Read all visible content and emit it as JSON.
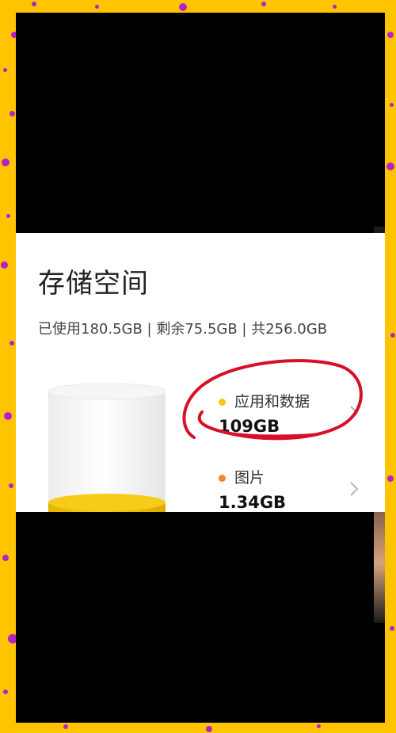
{
  "storage": {
    "title": "存储空间",
    "summary": "已使用180.5GB | 剩余75.5GB | 共256.0GB",
    "categories": [
      {
        "label": "应用和数据",
        "value": "109GB",
        "dot_color": "#F5C518"
      },
      {
        "label": "图片",
        "value": "1.34GB",
        "dot_color": "#F08A24"
      }
    ]
  },
  "colors": {
    "border_yellow": "#FFC400",
    "confetti_purple": "#B322C6",
    "annotation_red": "#D6102A",
    "cylinder_fill": "#F2C200"
  }
}
